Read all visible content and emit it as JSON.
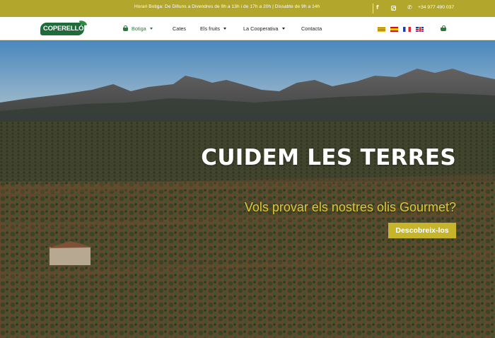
{
  "topbar": {
    "hours": "Horari Botiga: De Dilluns a Divendres de 9h a 13h i de 17h a 20h | Dissabte de 9h a 14h",
    "facebook_icon": "facebook-icon",
    "facebook_glyph": "f",
    "instagram_icon": "instagram-icon",
    "phone_icon": "phone-icon",
    "phone_glyph": "✆",
    "phone": "+34 977 490 037"
  },
  "nav": {
    "logo_text": "COPERELLÓ",
    "items": [
      {
        "label": "Botiga",
        "icon": "basket-icon",
        "dropdown": true,
        "active": true
      },
      {
        "label": "Cates",
        "dropdown": false
      },
      {
        "label": "Els fruits",
        "dropdown": true
      },
      {
        "label": "La Cooperativa",
        "dropdown": true
      },
      {
        "label": "Contacta",
        "dropdown": false
      }
    ],
    "languages": [
      "catalan-flag-icon",
      "spanish-flag-icon",
      "french-flag-icon",
      "english-flag-icon"
    ],
    "cart_icon": "shopping-basket-icon"
  },
  "hero": {
    "title": "CUIDEM LES TERRES",
    "subtitle": "Vols provar els nostres olis Gourmet?",
    "cta": "Descobreix-los"
  },
  "colors": {
    "topbar": "#b3a62d",
    "brand_green": "#1f6b3a",
    "accent_gold": "#c6b52a",
    "subtitle_gold": "#d9c837"
  }
}
